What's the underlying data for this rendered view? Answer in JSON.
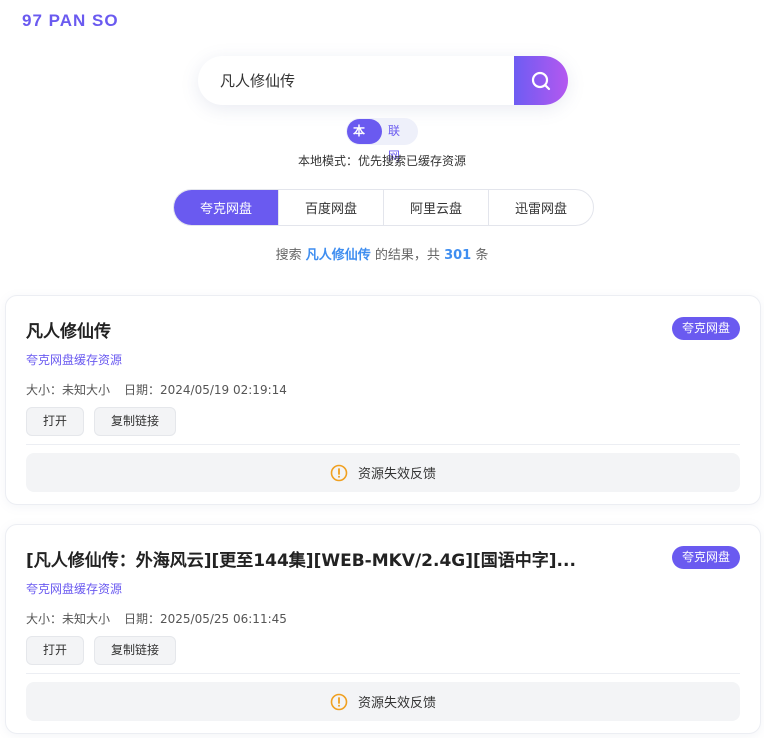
{
  "brand": "97 PAN SO",
  "search": {
    "value": "凡人修仙传",
    "button_icon": "search-icon"
  },
  "mode": {
    "local_label": "本地",
    "online_label": "联网",
    "hint": "本地模式：优先搜索已缓存资源"
  },
  "disk_tabs": [
    {
      "label": "夸克网盘",
      "active": true
    },
    {
      "label": "百度网盘",
      "active": false
    },
    {
      "label": "阿里云盘",
      "active": false
    },
    {
      "label": "迅雷网盘",
      "active": false
    }
  ],
  "summary": {
    "prefix": "搜索 ",
    "keyword": "凡人修仙传",
    "middle": " 的结果，共 ",
    "count": "301",
    "suffix": " 条"
  },
  "results": [
    {
      "title": "凡人修仙传",
      "badge": "夸克网盘",
      "source": "夸克网盘缓存资源",
      "size": "大小：未知大小",
      "date": "日期：2024/05/19 02:19:14",
      "open_label": "打开",
      "copy_label": "复制链接",
      "feedback_label": "资源失效反馈"
    },
    {
      "title": "[凡人修仙传：外海风云][更至144集][WEB-MKV/2.4G][国语中字]...",
      "badge": "夸克网盘",
      "source": "夸克网盘缓存资源",
      "size": "大小：未知大小",
      "date": "日期：2025/05/25 06:11:45",
      "open_label": "打开",
      "copy_label": "复制链接",
      "feedback_label": "资源失效反馈"
    }
  ],
  "colors": {
    "accent": "#6a5af0",
    "link_blue": "#3f8ef0",
    "warning": "#f0a020"
  }
}
